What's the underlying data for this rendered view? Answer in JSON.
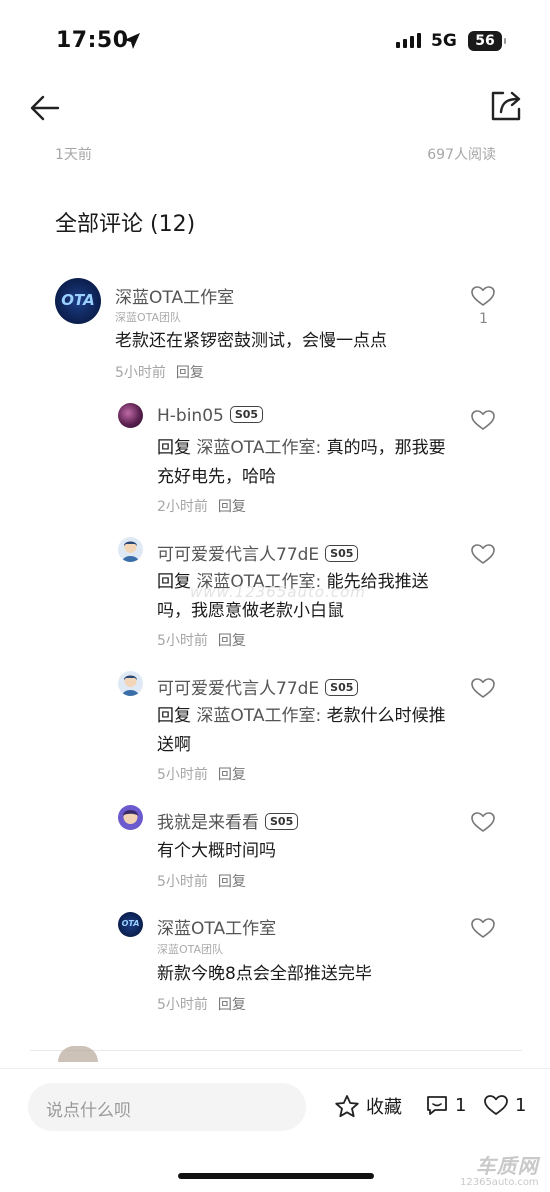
{
  "status_bar": {
    "time": "17:50",
    "network": "5G",
    "battery": "56"
  },
  "post_meta": {
    "time": "1天前",
    "reads": "697人阅读"
  },
  "comments_header": "全部评论 (12)",
  "comments": [
    {
      "name": "深蓝OTA工作室",
      "team": "深蓝OTA团队",
      "avatar_text": "OTA",
      "text": "老款还在紧锣密鼓测试，会慢一点点",
      "time": "5小时前",
      "reply_label": "回复",
      "likes": "1"
    },
    {
      "name": "H-bin05",
      "badge": "S05",
      "reply_prefix": "回复",
      "reply_target": "深蓝OTA工作室:",
      "text": "真的吗，那我要充好电先，哈哈",
      "time": "2小时前",
      "reply_label": "回复"
    },
    {
      "name": "可可爱爱代言人77dE",
      "badge": "S05",
      "reply_prefix": "回复",
      "reply_target": "深蓝OTA工作室:",
      "text": "能先给我推送吗，我愿意做老款小白鼠",
      "time": "5小时前",
      "reply_label": "回复"
    },
    {
      "name": "可可爱爱代言人77dE",
      "badge": "S05",
      "reply_prefix": "回复",
      "reply_target": "深蓝OTA工作室:",
      "text": "老款什么时候推送啊",
      "time": "5小时前",
      "reply_label": "回复"
    },
    {
      "name": "我就是来看看",
      "badge": "S05",
      "text": "有个大概时间吗",
      "time": "5小时前",
      "reply_label": "回复"
    },
    {
      "name": "深蓝OTA工作室",
      "team": "深蓝OTA团队",
      "avatar_text": "OTA",
      "text": "新款今晚8点会全部推送完毕",
      "time": "5小时前",
      "reply_label": "回复"
    }
  ],
  "bottom_bar": {
    "input_placeholder": "说点什么呗",
    "collect_label": "收藏",
    "comment_count": "1",
    "like_count": "1"
  },
  "watermark": {
    "logo": "车质网",
    "url": "12365auto.com",
    "center": "www.12365auto.com"
  },
  "colors": {
    "text_primary": "#1a1a1a",
    "text_secondary": "#a6a6a6",
    "name_gray": "#555555",
    "input_bg": "#f4f4f4",
    "ota_avatar_bg": "#0b1f4d"
  }
}
